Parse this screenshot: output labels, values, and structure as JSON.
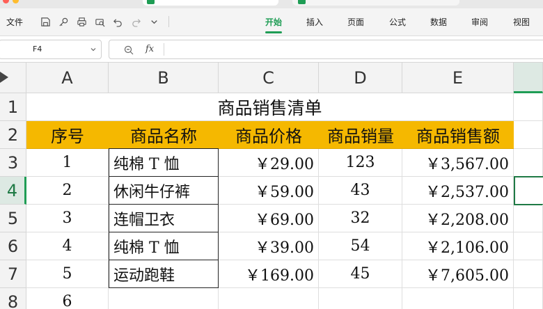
{
  "toolbar": {
    "file_label": "文件",
    "quick_access_icons": [
      "save-icon",
      "key-icon",
      "print-icon",
      "print-preview-icon",
      "undo-icon",
      "redo-icon",
      "dropdown-icon"
    ],
    "menu": [
      "开始",
      "插入",
      "页面",
      "公式",
      "数据",
      "审阅",
      "视图"
    ],
    "active_menu": "开始",
    "accent_color": "#1f9d55"
  },
  "formula_bar": {
    "cell_ref": "F4",
    "fx_label": "fx",
    "formula": ""
  },
  "sheet": {
    "columns": [
      "A",
      "B",
      "C",
      "D",
      "E"
    ],
    "rows": [
      "1",
      "2",
      "3",
      "4",
      "5",
      "6",
      "7",
      "8"
    ],
    "selected_row": "4",
    "title": "商品销售清单",
    "headers": [
      "序号",
      "商品名称",
      "商品价格",
      "商品销量",
      "商品销售额"
    ],
    "header_fill": "#f5b800",
    "data": [
      {
        "no": "1",
        "name": "纯棉 T 恤",
        "price": "￥29.00",
        "qty": "123",
        "sales": "￥3,567.00"
      },
      {
        "no": "2",
        "name": "休闲牛仔裤",
        "price": "￥59.00",
        "qty": "43",
        "sales": "￥2,537.00"
      },
      {
        "no": "3",
        "name": "连帽卫衣",
        "price": "￥69.00",
        "qty": "32",
        "sales": "￥2,208.00"
      },
      {
        "no": "4",
        "name": "纯棉 T 恤",
        "price": "￥39.00",
        "qty": "54",
        "sales": "￥2,106.00"
      },
      {
        "no": "5",
        "name": "运动跑鞋",
        "price": "￥169.00",
        "qty": "45",
        "sales": "￥7,605.00"
      }
    ],
    "row8_no": "6"
  }
}
